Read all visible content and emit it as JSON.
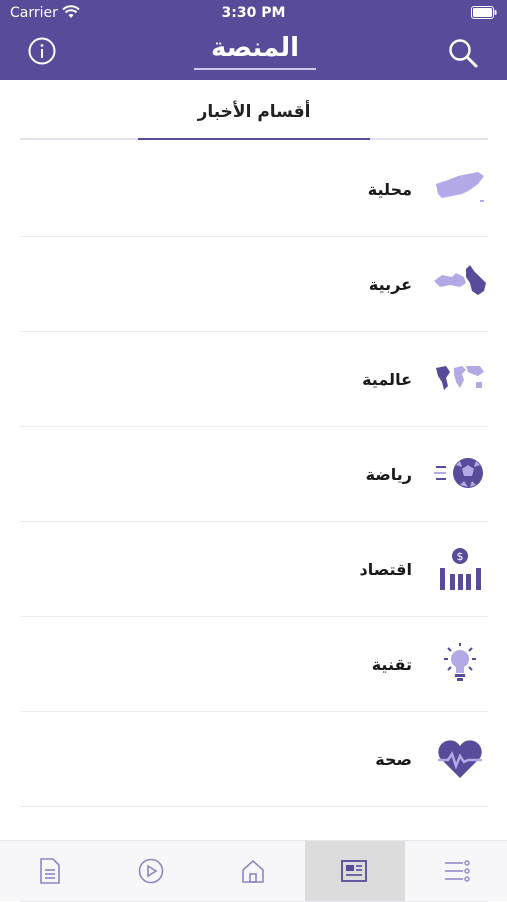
{
  "status_bar": {
    "carrier": "Carrier",
    "time": "3:30 PM"
  },
  "header": {
    "logo_text": "المنصة",
    "info_icon": "info-icon",
    "search_icon": "search-icon"
  },
  "section": {
    "title": "أقسام الأخبار"
  },
  "categories": [
    {
      "label": "محلية",
      "icon": "yemen-map-icon"
    },
    {
      "label": "عربية",
      "icon": "arab-world-map-icon"
    },
    {
      "label": "عالمية",
      "icon": "world-map-icon"
    },
    {
      "label": "رياضة",
      "icon": "soccer-ball-icon"
    },
    {
      "label": "اقتصاد",
      "icon": "economy-chart-icon"
    },
    {
      "label": "تقنية",
      "icon": "lightbulb-icon"
    },
    {
      "label": "صحة",
      "icon": "heartbeat-icon"
    }
  ],
  "tabs": [
    {
      "icon": "document-icon"
    },
    {
      "icon": "play-icon"
    },
    {
      "icon": "home-icon"
    },
    {
      "icon": "news-icon",
      "active": true
    },
    {
      "icon": "menu-list-icon"
    }
  ],
  "colors": {
    "brand": "#574b9a",
    "icon_light": "#b3a9e6",
    "icon_dark": "#574b9a"
  }
}
